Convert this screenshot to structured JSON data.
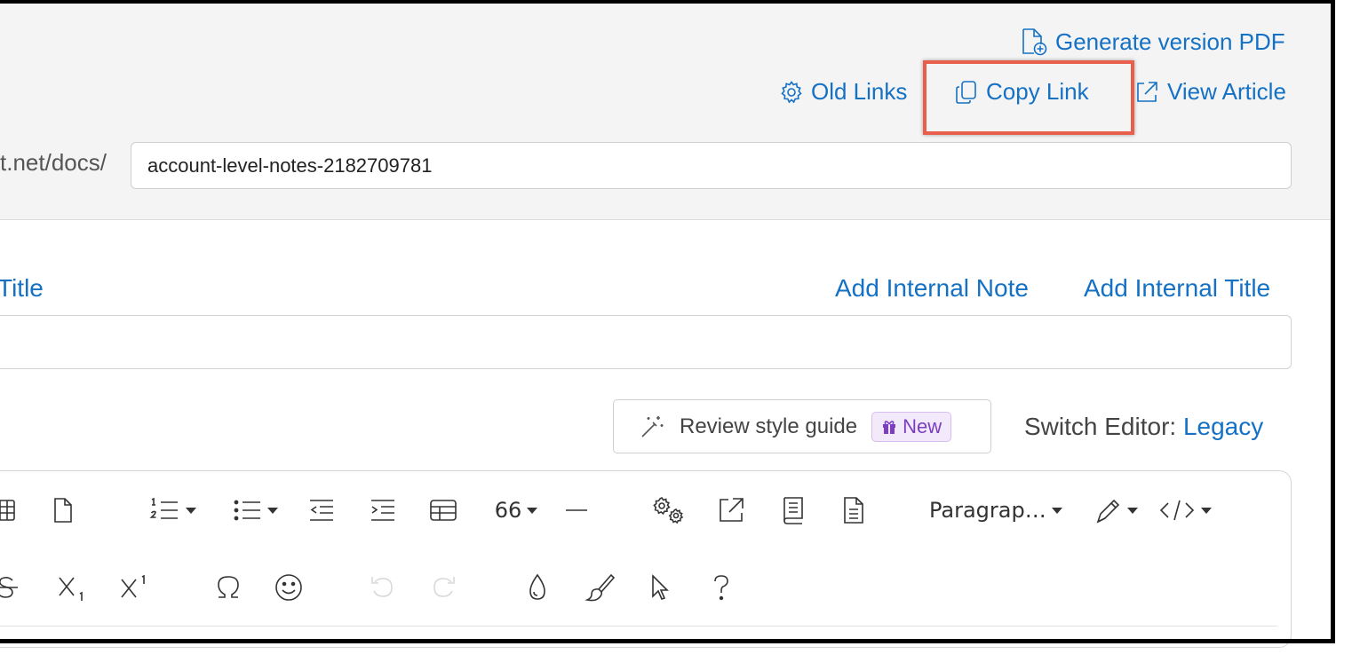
{
  "header_links": {
    "generate_pdf": "Generate version PDF",
    "old_links": "Old Links",
    "copy_link": "Copy Link",
    "view_article": "View Article"
  },
  "url": {
    "prefix": "t.net/docs/",
    "slug": "account-level-notes-2182709781"
  },
  "title_row": {
    "title_label_partial": "Title",
    "add_internal_note": "Add Internal Note",
    "add_internal_title": "Add Internal Title"
  },
  "style_guide": {
    "label": "Review style guide",
    "badge": "New"
  },
  "switch_editor": {
    "label": "Switch Editor:",
    "value": "Legacy"
  },
  "toolbar": {
    "quote_label": "66",
    "paragraph_label": "Paragrap…"
  },
  "colors": {
    "link": "#1471c4",
    "highlight": "#e8604c",
    "badge_bg": "#f2e9fb",
    "badge_text": "#7b3fbf"
  }
}
